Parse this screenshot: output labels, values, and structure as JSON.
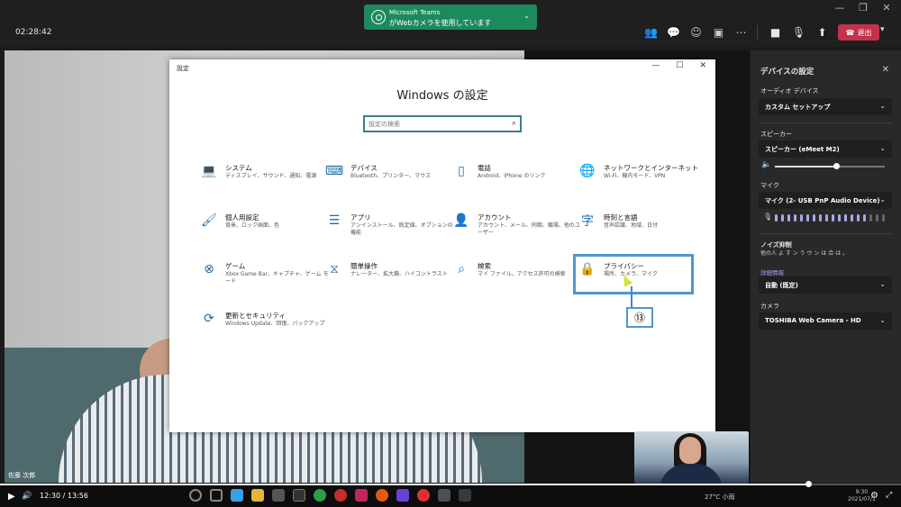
{
  "top_bar": {
    "timer": "02:28:42",
    "toast_app": "Microsoft Teams",
    "toast_message": "がWebカメラを使用しています",
    "leave_label": "退出"
  },
  "video": {
    "participant_name": "佐藤 次郎"
  },
  "settings_window": {
    "window_title": "設定",
    "heading": "Windows の設定",
    "search_placeholder": "設定の検索",
    "tiles": [
      {
        "title": "システム",
        "desc": "ディスプレイ、サウンド、通知、電源",
        "icon": "laptop-icon"
      },
      {
        "title": "デバイス",
        "desc": "Bluetooth、プリンター、マウス",
        "icon": "keyboard-icon"
      },
      {
        "title": "電話",
        "desc": "Android、iPhone のリンク",
        "icon": "phone-icon"
      },
      {
        "title": "ネットワークとインターネット",
        "desc": "Wi-Fi、機内モード、VPN",
        "icon": "globe-icon"
      },
      {
        "title": "個人用設定",
        "desc": "背景、ロック画面、色",
        "icon": "brush-icon"
      },
      {
        "title": "アプリ",
        "desc": "アンインストール、既定値、オプションの機能",
        "icon": "apps-list-icon"
      },
      {
        "title": "アカウント",
        "desc": "アカウント、メール、同期、職場、他のユーザー",
        "icon": "person-icon"
      },
      {
        "title": "時刻と言語",
        "desc": "音声認識、地域、日付",
        "icon": "time-language-icon"
      },
      {
        "title": "ゲーム",
        "desc": "Xbox Game Bar、キャプチャ、ゲーム モード",
        "icon": "xbox-icon"
      },
      {
        "title": "簡単操作",
        "desc": "ナレーター、拡大鏡、ハイコントラスト",
        "icon": "ease-of-access-icon"
      },
      {
        "title": "検索",
        "desc": "マイ ファイル、アクセス許可の検索",
        "icon": "search-icon"
      },
      {
        "title": "プライバシー",
        "desc": "場所、カメラ、マイク",
        "icon": "lock-icon"
      },
      {
        "title": "更新とセキュリティ",
        "desc": "Windows Update、回復、バックアップ",
        "icon": "refresh-icon"
      }
    ],
    "callout_number": "⑬"
  },
  "device_panel": {
    "title": "デバイスの設定",
    "audio_device_label": "オーディオ デバイス",
    "audio_device_value": "カスタム セットアップ",
    "speaker_label": "スピーカー",
    "speaker_value": "スピーカー (eMeet M2)",
    "speaker_volume": 0.56,
    "mic_label": "マイク",
    "mic_value": "マイク (2- USB PnP Audio Device)",
    "mic_level_active_bars": 15,
    "mic_level_total_bars": 18,
    "noise_label": "ノイズ抑制",
    "noise_desc": "他の人 よ す ン う ウ ン は 合 は 。",
    "noise_link": "詳細情報",
    "noise_value": "自動 (既定)",
    "camera_label": "カメラ",
    "camera_value": "TOSHIBA Web Camera - HD"
  },
  "player": {
    "current_time": "12:30",
    "separator": "/",
    "duration": "13:56",
    "progress": 0.897,
    "tray_text": "27°C 小雨",
    "clock_time": "9:30",
    "clock_date": "2021/07/1"
  }
}
